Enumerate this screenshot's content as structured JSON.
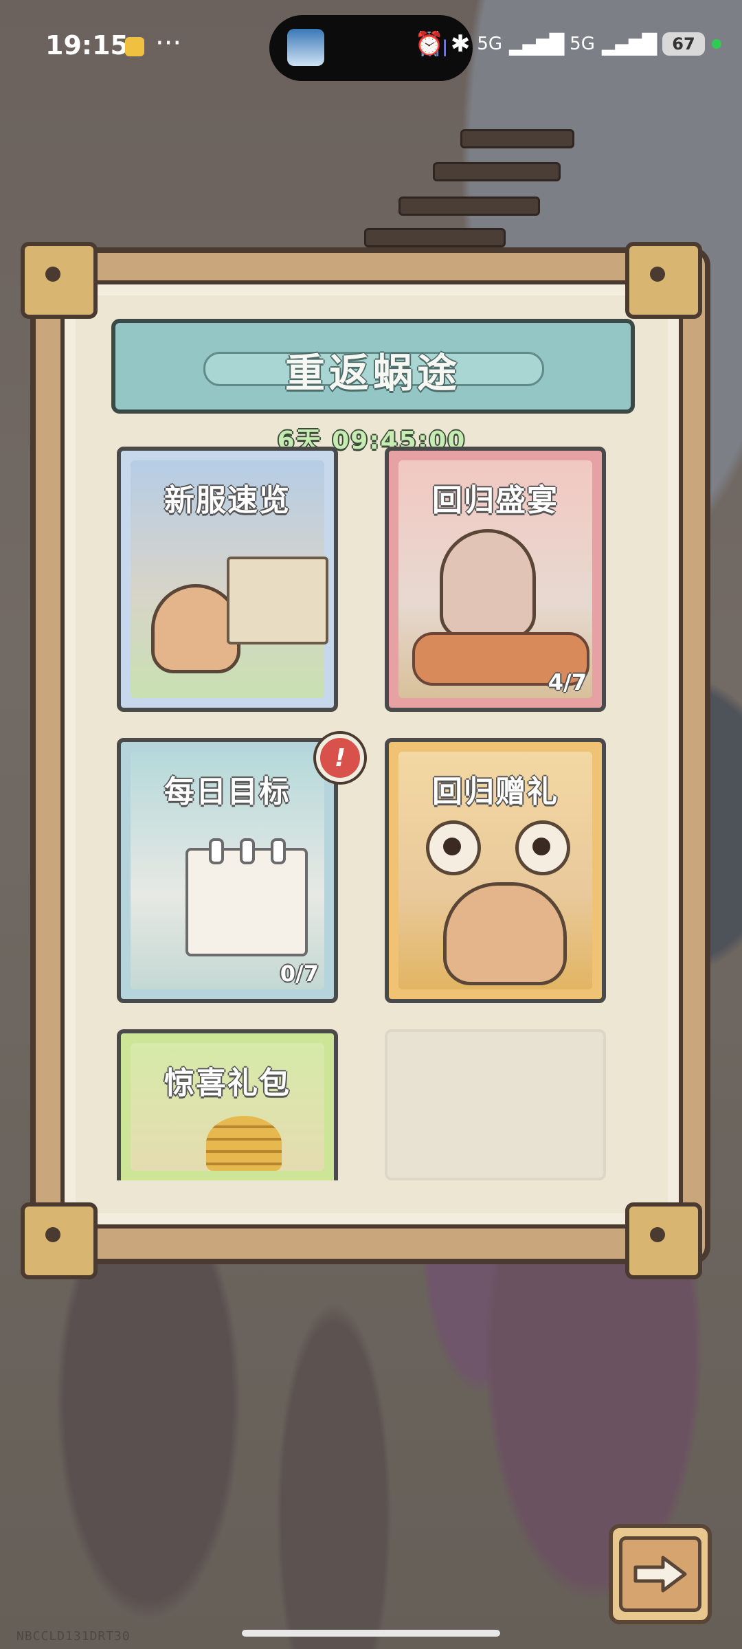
{
  "status_bar": {
    "time": "19:15",
    "dots": "···",
    "net1": "5G",
    "net2": "5G",
    "battery": "67"
  },
  "event": {
    "title": "重返蜗途",
    "countdown": "6天 09:45:00"
  },
  "cards": {
    "preview": {
      "label": "新服速览"
    },
    "feast": {
      "label": "回归盛宴",
      "progress": "4/7"
    },
    "daily": {
      "label": "每日目标",
      "progress": "0/7"
    },
    "gift": {
      "label": "回归赠礼"
    },
    "pack": {
      "label": "惊喜礼包"
    }
  },
  "badge": "!",
  "watermark": "NBCCLD131DRT30",
  "colors": {
    "banner": "#93c6c4",
    "countdown": "#c6ecb3",
    "badge": "#d9514b"
  }
}
